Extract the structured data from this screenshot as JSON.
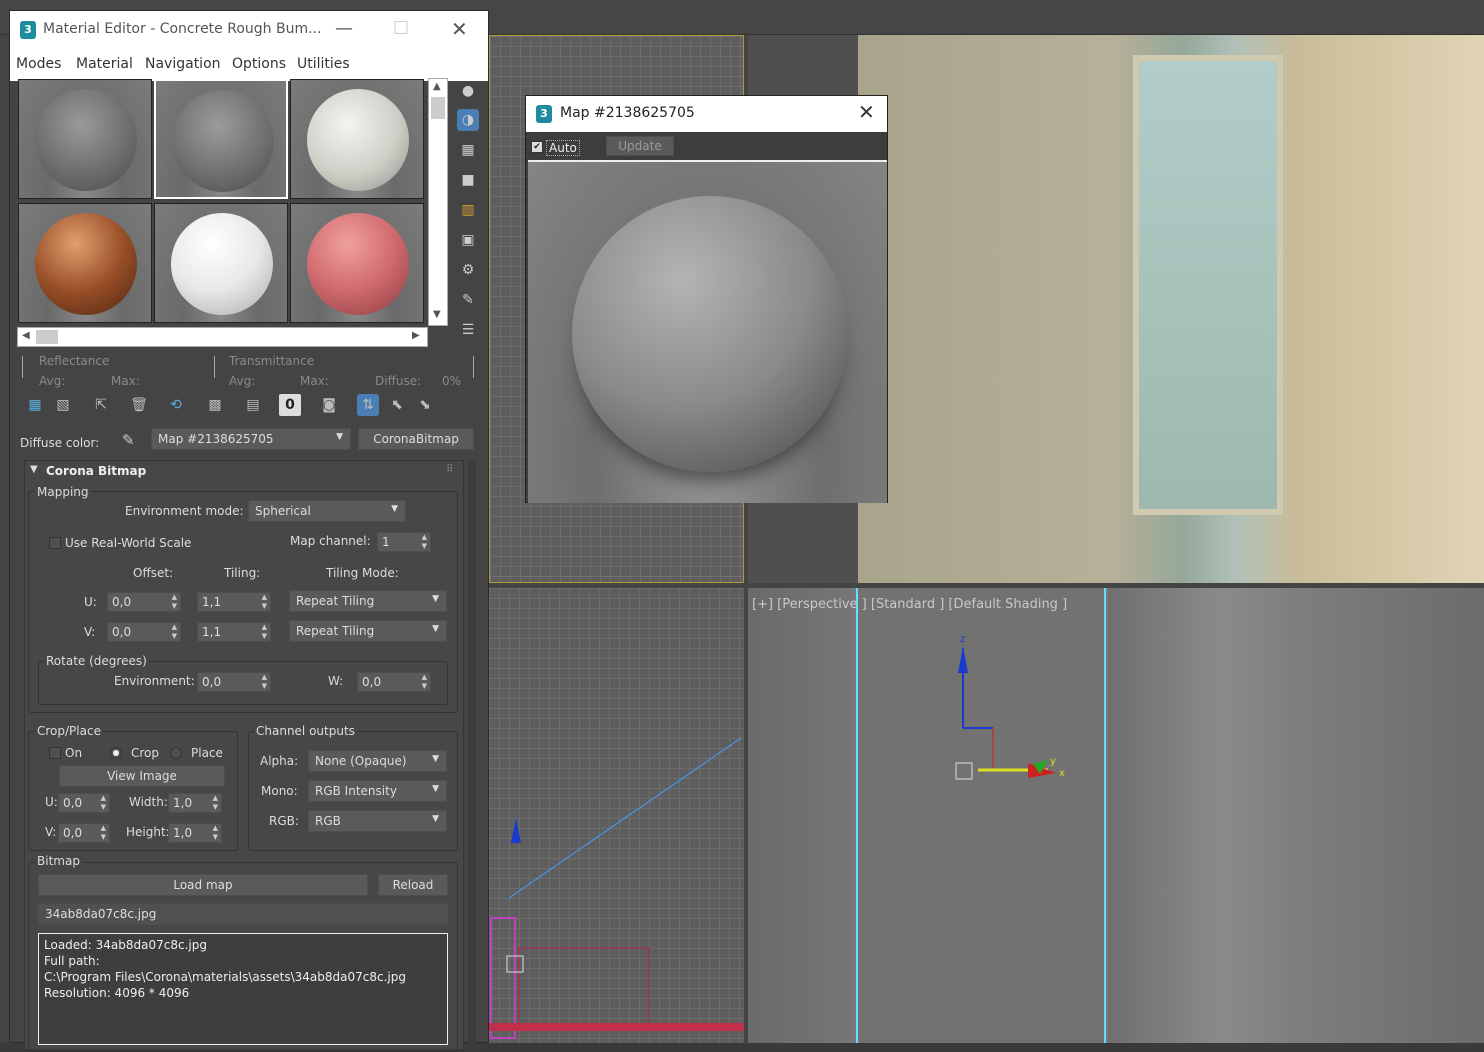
{
  "material_editor": {
    "title": "Material Editor - Concrete Rough Bum...",
    "menu": [
      "Modes",
      "Material",
      "Navigation",
      "Options",
      "Utilities"
    ],
    "reflectance": {
      "label": "Reflectance",
      "avg": "Avg:",
      "max": "Max:"
    },
    "transmittance": {
      "label": "Transmittance",
      "avg": "Avg:",
      "max": "Max:",
      "diffuse": "Diffuse:",
      "diffuse_value": "0%"
    },
    "diffuse_color_label": "Diffuse color:",
    "map_combo": "Map #2138625705",
    "map_type_button": "CoronaBitmap",
    "rollout_title": "Corona Bitmap",
    "mapping": {
      "label": "Mapping",
      "env_mode_label": "Environment mode:",
      "env_mode_value": "Spherical",
      "real_world_label": "Use Real-World Scale",
      "map_channel_label": "Map channel:",
      "map_channel_value": "1",
      "offset_header": "Offset:",
      "tiling_header": "Tiling:",
      "tiling_mode_header": "Tiling Mode:",
      "u_label": "U:",
      "v_label": "V:",
      "u_offset": "0,0",
      "v_offset": "0,0",
      "u_tiling": "1,1",
      "v_tiling": "1,1",
      "u_tiling_mode": "Repeat Tiling",
      "v_tiling_mode": "Repeat Tiling"
    },
    "rotate": {
      "label": "Rotate (degrees)",
      "env_label": "Environment:",
      "env_value": "0,0",
      "w_label": "W:",
      "w_value": "0,0"
    },
    "crop_place": {
      "label": "Crop/Place",
      "on": "On",
      "crop": "Crop",
      "place": "Place",
      "view_image": "View Image",
      "u_label": "U:",
      "u_value": "0,0",
      "v_label": "V:",
      "v_value": "0,0",
      "width_label": "Width:",
      "width_value": "1,0",
      "height_label": "Height:",
      "height_value": "1,0"
    },
    "channel_outputs": {
      "label": "Channel outputs",
      "alpha_label": "Alpha:",
      "alpha_value": "None (Opaque)",
      "mono_label": "Mono:",
      "mono_value": "RGB Intensity",
      "rgb_label": "RGB:",
      "rgb_value": "RGB"
    },
    "bitmap": {
      "label": "Bitmap",
      "load_map": "Load map",
      "reload": "Reload",
      "filename": "34ab8da07c8c.jpg",
      "info": [
        "Loaded: 34ab8da07c8c.jpg",
        "Full path:",
        "C:\\Program Files\\Corona\\materials\\assets\\34ab8da07c8c.jpg",
        "Resolution: 4096 * 4096"
      ]
    }
  },
  "map_window": {
    "title": "Map #2138625705",
    "auto_label": "Auto",
    "update_label": "Update"
  },
  "viewport": {
    "label": "[+] [Perspective ] [Standard ] [Default Shading ]",
    "axis_z": "z",
    "axis_y": "y",
    "axis_x": "x"
  },
  "colors": {
    "accent": "#4a7fb5",
    "panel": "#444444",
    "titlebar": "#ffffff"
  }
}
